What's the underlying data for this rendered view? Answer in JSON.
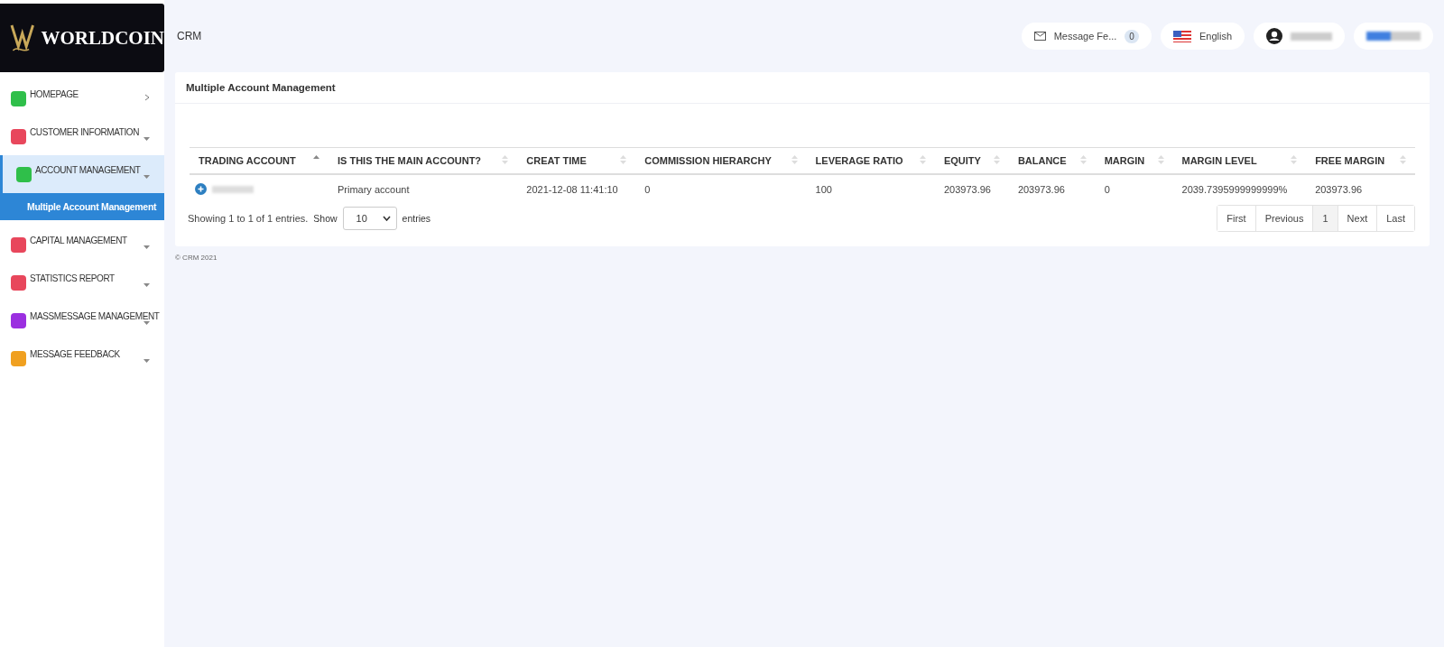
{
  "logo": {
    "text": "WORLDCOIN"
  },
  "header": {
    "title": "CRM",
    "message_button": {
      "label": "Message Fe...",
      "count": "0"
    },
    "language": {
      "label": "English"
    }
  },
  "sidebar": {
    "items": [
      {
        "label": "HOMEPAGE",
        "color": "#2fbf4a",
        "expanded": false,
        "kind": "link"
      },
      {
        "label": "CUSTOMER INFORMATION",
        "color": "#e8475c",
        "expanded": false,
        "kind": "group"
      },
      {
        "label": "ACCOUNT MANAGEMENT",
        "color": "#2fbf4a",
        "expanded": true,
        "kind": "group",
        "children": [
          {
            "label": "Multiple Account Management",
            "selected": true
          }
        ]
      },
      {
        "label": "CAPITAL MANAGEMENT",
        "color": "#e8475c",
        "expanded": false,
        "kind": "group"
      },
      {
        "label": "STATISTICS REPORT",
        "color": "#e8475c",
        "expanded": false,
        "kind": "group"
      },
      {
        "label": "MASSMESSAGE MANAGEMENT",
        "color": "#9b2fe0",
        "expanded": false,
        "kind": "group"
      },
      {
        "label": "MESSAGE FEEDBACK",
        "color": "#f0a020",
        "expanded": false,
        "kind": "group"
      }
    ]
  },
  "panel": {
    "title": "Multiple Account Management",
    "table": {
      "columns": [
        {
          "label": "TRADING ACCOUNT",
          "sorted": true
        },
        {
          "label": "IS THIS THE MAIN ACCOUNT?",
          "sorted": false
        },
        {
          "label": "CREAT TIME",
          "sorted": false
        },
        {
          "label": "COMMISSION HIERARCHY",
          "sorted": false
        },
        {
          "label": "LEVERAGE RATIO",
          "sorted": false
        },
        {
          "label": "EQUITY",
          "sorted": false
        },
        {
          "label": "BALANCE",
          "sorted": false
        },
        {
          "label": "MARGIN",
          "sorted": false
        },
        {
          "label": "MARGIN LEVEL",
          "sorted": false
        },
        {
          "label": "FREE MARGIN",
          "sorted": false
        }
      ],
      "rows": [
        {
          "cells": [
            "",
            "Primary account",
            "2021-12-08 11:41:10",
            "0",
            "100",
            "203973.96",
            "203973.96",
            "0",
            "2039.7395999999999%",
            "203973.96"
          ]
        }
      ]
    },
    "info": "Showing 1 to 1 of 1 entries.",
    "show_label": "Show",
    "page_size": "10",
    "entries_label": "entries",
    "pagination": [
      {
        "label": "First",
        "selected": false
      },
      {
        "label": "Previous",
        "selected": false
      },
      {
        "label": "1",
        "selected": true
      },
      {
        "label": "Next",
        "selected": false
      },
      {
        "label": "Last",
        "selected": false
      }
    ]
  },
  "footer": "© CRM 2021"
}
